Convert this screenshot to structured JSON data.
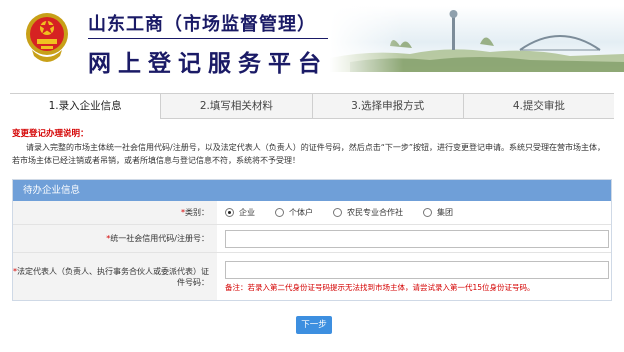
{
  "header": {
    "title": "山东工商（市场监督管理）",
    "subtitle": "网上登记服务平台",
    "emblem_icon": "national-emblem-icon"
  },
  "tabs": [
    {
      "label": "1.录入企业信息",
      "active": true
    },
    {
      "label": "2.填写相关材料",
      "active": false
    },
    {
      "label": "3.选择申报方式",
      "active": false
    },
    {
      "label": "4.提交审批",
      "active": false
    }
  ],
  "notice": {
    "title": "变更登记办理说明：",
    "body": "请录入完整的市场主体统一社会信用代码/注册号，以及法定代表人（负责人）的证件号码，然后点击“下一步”按钮，进行变更登记申请。系统只受理在营市场主体，若市场主体已经注销或者吊销，或者所填信息与登记信息不符，系统将不予受理！"
  },
  "form": {
    "panel_title": "待办企业信息",
    "type_field": {
      "required_mark": "*",
      "label": "类别：",
      "options": [
        {
          "label": "企业",
          "selected": true
        },
        {
          "label": "个体户",
          "selected": false
        },
        {
          "label": "农民专业合作社",
          "selected": false
        },
        {
          "label": "集团",
          "selected": false
        }
      ]
    },
    "credit_code_field": {
      "required_mark": "*",
      "label": "统一社会信用代码/注册号：",
      "value": ""
    },
    "id_number_field": {
      "required_mark": "*",
      "label": "法定代表人（负责人、执行事务合伙人或委派代表）证件号码：",
      "value": "",
      "hint": "备注：若录入第二代身份证号码提示无法找到市场主体，请尝试录入第一代15位身份证号码。"
    }
  },
  "actions": {
    "next_label": "下一步"
  },
  "colors": {
    "panel_header": "#6f9fd8",
    "button": "#3d8fe0",
    "required": "#d40000",
    "title_navy": "#1a1a66"
  }
}
